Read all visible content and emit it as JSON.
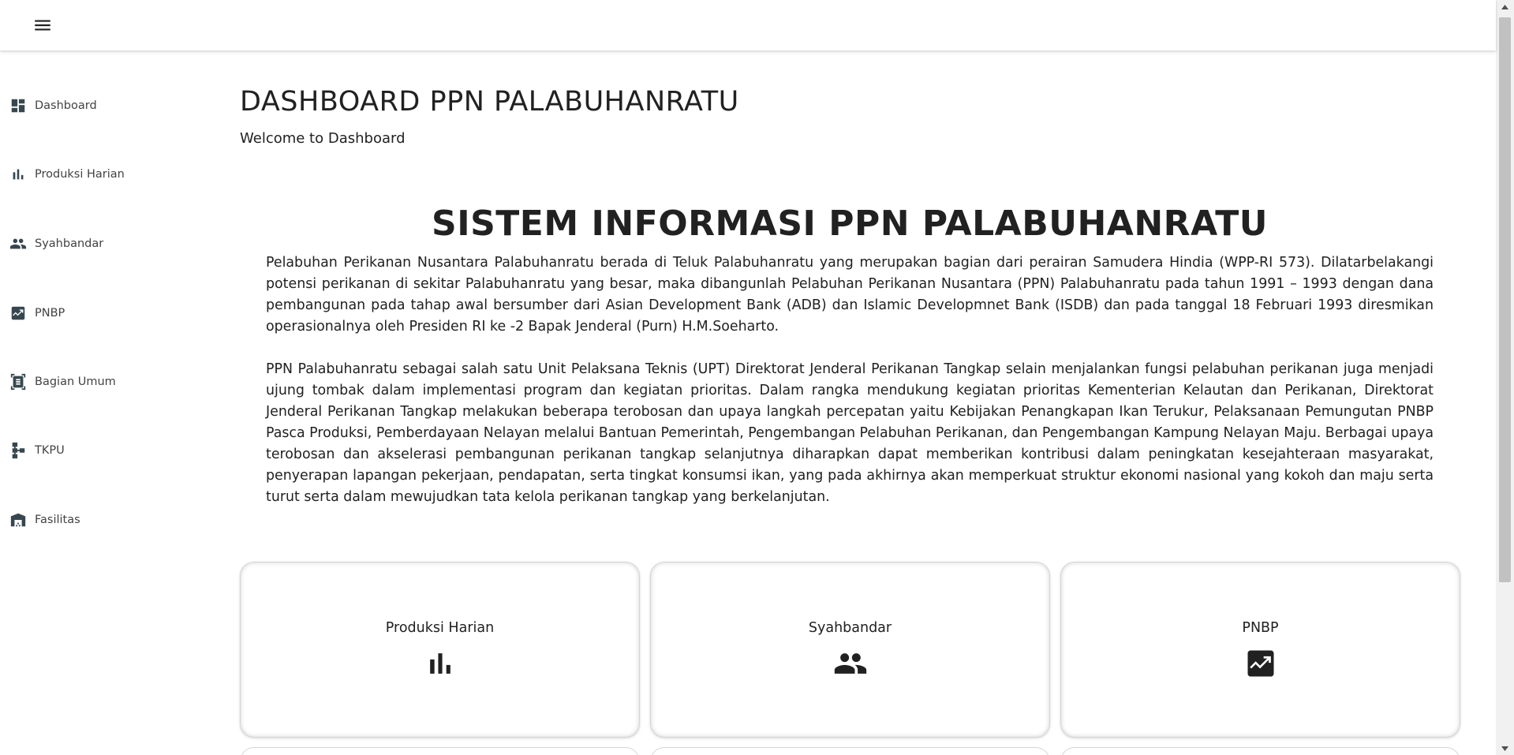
{
  "appbar": {
    "menu_icon": "menu-icon"
  },
  "sidebar": {
    "items": [
      {
        "label": "Dashboard",
        "icon": "dashboard-icon"
      },
      {
        "label": "Produksi Harian",
        "icon": "bar-chart-icon"
      },
      {
        "label": "Syahbandar",
        "icon": "people-icon"
      },
      {
        "label": "PNBP",
        "icon": "trending-up-icon"
      },
      {
        "label": "Bagian Umum",
        "icon": "document-scanner-icon"
      },
      {
        "label": "TKPU",
        "icon": "schema-icon"
      },
      {
        "label": "Fasilitas",
        "icon": "warehouse-icon"
      }
    ]
  },
  "main": {
    "title": "DASHBOARD PPN PALABUHANRATU",
    "subtitle": "Welcome to Dashboard",
    "system_title": "SISTEM INFORMASI PPN PALABUHANRATU",
    "paragraph1": "Pelabuhan Perikanan Nusantara Palabuhanratu berada di Teluk Palabuhanratu yang merupakan bagian dari perairan Samudera Hindia (WPP-RI 573). Dilatarbelakangi potensi perikanan di sekitar Palabuhanratu yang besar, maka dibangunlah Pelabuhan Perikanan Nusantara (PPN) Palabuhanratu pada tahun 1991 – 1993 dengan dana pembangunan pada tahap awal bersumber dari Asian Development Bank (ADB) dan Islamic Developmnet Bank (ISDB) dan pada tanggal 18 Februari 1993 diresmikan operasionalnya oleh Presiden RI ke -2 Bapak Jenderal (Purn) H.M.Soeharto.",
    "paragraph2": "PPN Palabuhanratu sebagai salah satu Unit Pelaksana Teknis (UPT) Direktorat Jenderal Perikanan Tangkap selain menjalankan fungsi pelabuhan perikanan juga menjadi ujung tombak dalam implementasi program dan kegiatan prioritas. Dalam rangka mendukung kegiatan prioritas Kementerian Kelautan dan Perikanan, Direktorat Jenderal Perikanan Tangkap melakukan beberapa terobosan dan upaya langkah percepatan yaitu Kebijakan Penangkapan Ikan Terukur, Pelaksanaan Pemungutan PNBP Pasca Produksi, Pemberdayaan Nelayan melalui Bantuan Pemerintah, Pengembangan Pelabuhan Perikanan, dan Pengembangan Kampung Nelayan Maju. Berbagai upaya terobosan dan akselerasi pembangunan perikanan tangkap selanjutnya diharapkan dapat memberikan kontribusi dalam peningkatan kesejahteraan masyarakat, penyerapan lapangan pekerjaan, pendapatan, serta tingkat konsumsi ikan, yang pada akhirnya akan memperkuat struktur ekonomi nasional yang kokoh dan maju serta turut serta dalam mewujudkan tata kelola perikanan tangkap yang berkelanjutan.",
    "cards": [
      {
        "label": "Produksi Harian",
        "icon": "bar-chart-icon"
      },
      {
        "label": "Syahbandar",
        "icon": "people-icon"
      },
      {
        "label": "PNBP",
        "icon": "trending-up-icon"
      }
    ]
  },
  "colors": {
    "text": "#212121",
    "icon": "#37474f",
    "card_border": "#d6d6d6"
  }
}
